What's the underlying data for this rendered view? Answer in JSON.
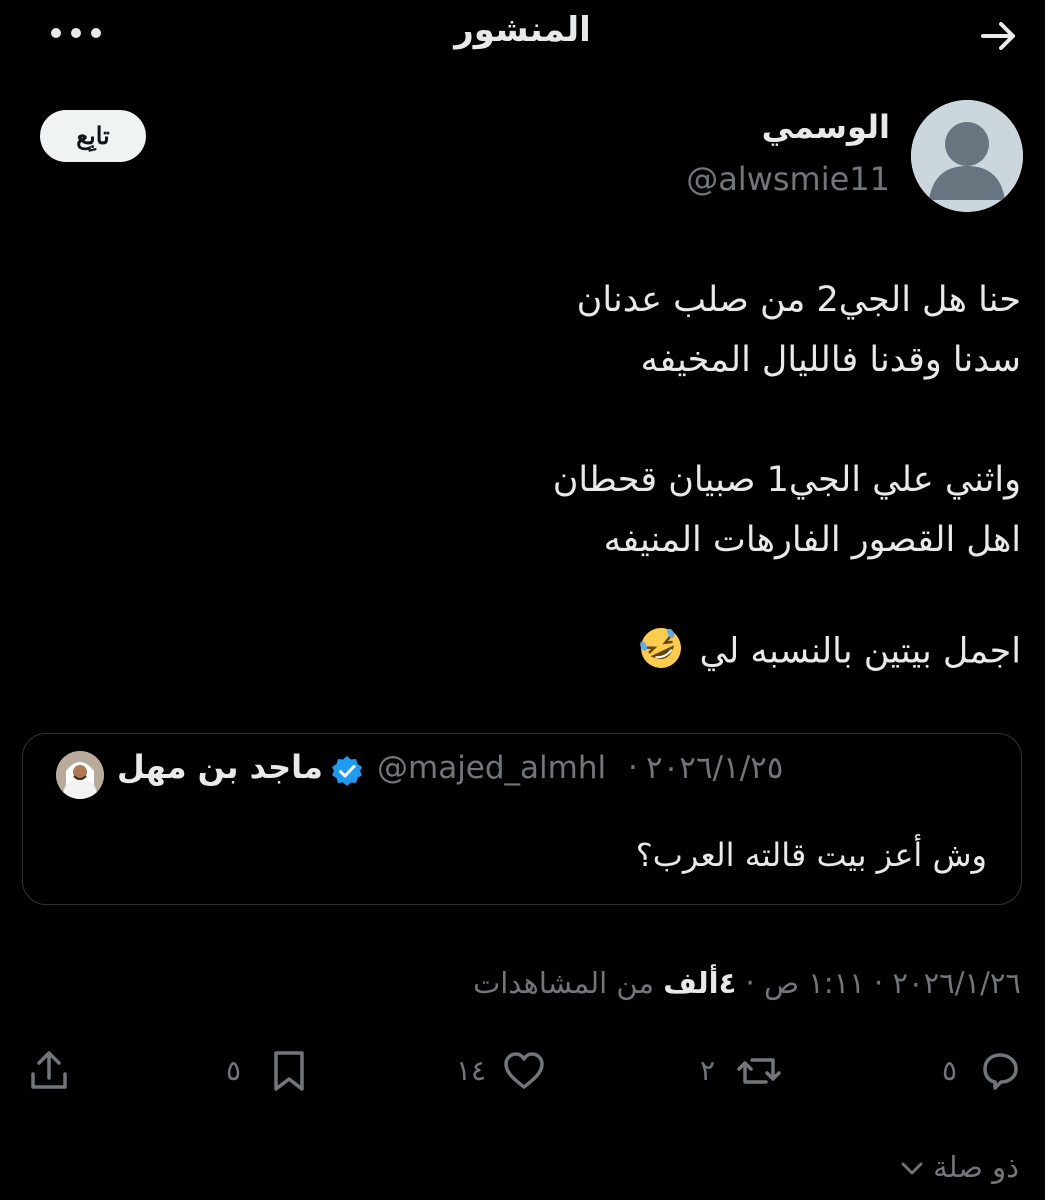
{
  "header": {
    "title": "المنشور"
  },
  "tweet": {
    "author": {
      "display_name": "الوسمي",
      "handle": "@alwsmie11"
    },
    "follow_label": "تابِع",
    "lines": [
      "حنا هل الجي2 من صلب عدنان",
      "سدنا وقدنا فالليال المخيفه",
      "واثني علي الجي1 صبيان قحطان",
      "اهل القصور الفارهات المنيفه",
      "اجمل بيتين بالنسبه لي"
    ],
    "emoji": "rolling-on-floor-laughing-emoji"
  },
  "quote": {
    "name": "ماجد بن مهل",
    "handle": "@majed_almhl",
    "separator": "·",
    "date": "٢٠٢٦/١/٢٥",
    "text": "وش أعز بيت قالته العرب؟"
  },
  "meta": {
    "time": "١:١١ ص",
    "date": "٢٠٢٦/١/٢٦",
    "views": "٤ألف",
    "views_label": "من المشاهدات",
    "separator": "·"
  },
  "actions": {
    "replies": "٥",
    "reposts": "٢",
    "likes": "١٤",
    "bookmarks": "٥"
  },
  "thread_label": "ذو صلة",
  "colors": {
    "background": "#000000",
    "text": "#e7e9ea",
    "muted": "#71767b",
    "border": "#2f3336",
    "verified": "#1d9bf0"
  }
}
